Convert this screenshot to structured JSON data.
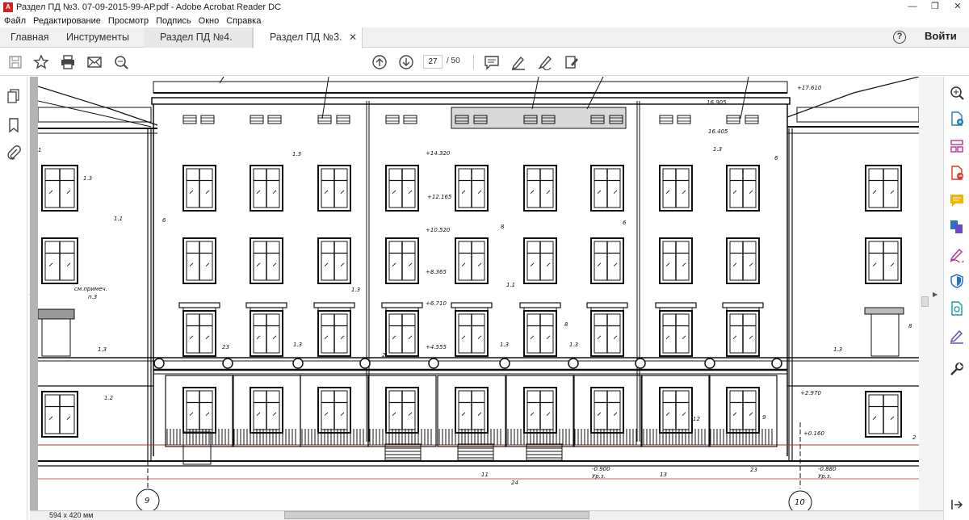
{
  "window": {
    "title": "Раздел ПД №3. 07-09-2015-99-АР.pdf - Adobe Acrobat Reader DC",
    "minimize": "—",
    "maximize": "❐",
    "close": "✕"
  },
  "menu": [
    "Файл",
    "Редактирование",
    "Просмотр",
    "Подпись",
    "Окно",
    "Справка"
  ],
  "tabs": {
    "home": "Главная",
    "tools": "Инструменты",
    "doc1": "Раздел ПД №4. 07...",
    "doc2": "Раздел ПД №3. 07...",
    "close": "✕"
  },
  "header": {
    "help": "?",
    "signin": "Войти"
  },
  "toolbar": {
    "page_current": "27",
    "page_total": "/ 50"
  },
  "status": {
    "page_size": "594 x 420 мм"
  },
  "drawing": {
    "labels": {
      "l_176": "+17.610",
      "l_14320": "+14.320",
      "l_12165": "+12.165",
      "l_10520": "+10.520",
      "l_8365": "+8.365",
      "l_6710": "+6.710",
      "l_4555": "+4.555",
      "l_16905": "16.905",
      "l_16405": "16.405",
      "l_2970": "+2.970",
      "l_0160": "+0.160",
      "l_0900": "-0.900",
      "l_0880": "-0.880",
      "ur1": "Ур.з.",
      "ur2": "Ур.з.",
      "m13a": "1.3",
      "m13b": "1.3",
      "m13c": "1.3",
      "m13d": "1.3",
      "m13e": "1.3",
      "m13f": "1.3",
      "m13g": "1.3",
      "m13h": "1.3",
      "m13i": "1.3",
      "m13j": "1.3",
      "m13k": "13",
      "m11a": "1.1",
      "m11b": "1.1",
      "m12": "1.2",
      "m6a": "6",
      "m6b": "6",
      "m6c": "6",
      "m8a": "8",
      "m8b": "8",
      "m8c": "8",
      "m23a": "23",
      "m23b": "23",
      "m11n": "11",
      "m24": "24",
      "m12n": "12",
      "m9n": "9",
      "m2": "2",
      "m2b": "2",
      "m1": "1",
      "note1": "см.примеч.",
      "note2": "п.3",
      "axis9": "9",
      "axis10": "10"
    }
  }
}
